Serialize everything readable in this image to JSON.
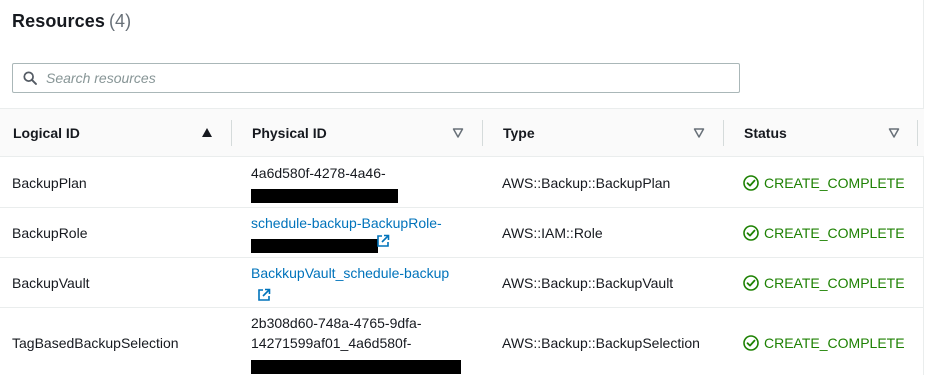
{
  "panel": {
    "title": "Resources",
    "count": "(4)"
  },
  "search": {
    "placeholder": "Search resources",
    "value": ""
  },
  "columns": [
    {
      "label": "Logical ID",
      "sort": "ascending"
    },
    {
      "label": "Physical ID",
      "sort": "none"
    },
    {
      "label": "Type",
      "sort": "none"
    },
    {
      "label": "Status",
      "sort": "none"
    }
  ],
  "rows": [
    {
      "logical_id": "BackupPlan",
      "physical_id_line1": "4a6d580f-4278-4a46-",
      "physical_id_line2": "",
      "physical_id_line3": "",
      "physical_is_link": false,
      "type": "AWS::Backup::BackupPlan",
      "status": "CREATE_COMPLETE"
    },
    {
      "logical_id": "BackupRole",
      "physical_id_line1": "schedule-backup-BackupRole-",
      "physical_id_line2": "",
      "physical_id_line3": "",
      "physical_is_link": true,
      "type": "AWS::IAM::Role",
      "status": "CREATE_COMPLETE"
    },
    {
      "logical_id": "BackupVault",
      "physical_id_line1": "BackkupVault_schedule-backup",
      "physical_id_line2": "",
      "physical_id_line3": "",
      "physical_is_link": true,
      "type": "AWS::Backup::BackupVault",
      "status": "CREATE_COMPLETE"
    },
    {
      "logical_id": "TagBasedBackupSelection",
      "physical_id_line1": "2b308d60-748a-4765-9dfa-",
      "physical_id_line2": "14271599af01_4a6d580f-",
      "physical_id_line3": "",
      "physical_is_link": false,
      "type": "AWS::Backup::BackupSelection",
      "status": "CREATE_COMPLETE"
    }
  ],
  "colors": {
    "link": "#0073bb",
    "success": "#1d8102",
    "border": "#eaeded",
    "header_bg": "#fafafa"
  },
  "icons": {
    "search": "search-icon",
    "sort_asc": "sort-ascending-icon",
    "sort_none": "sort-caret-down-icon",
    "external": "external-link-icon",
    "status_ok": "check-circle-icon"
  }
}
